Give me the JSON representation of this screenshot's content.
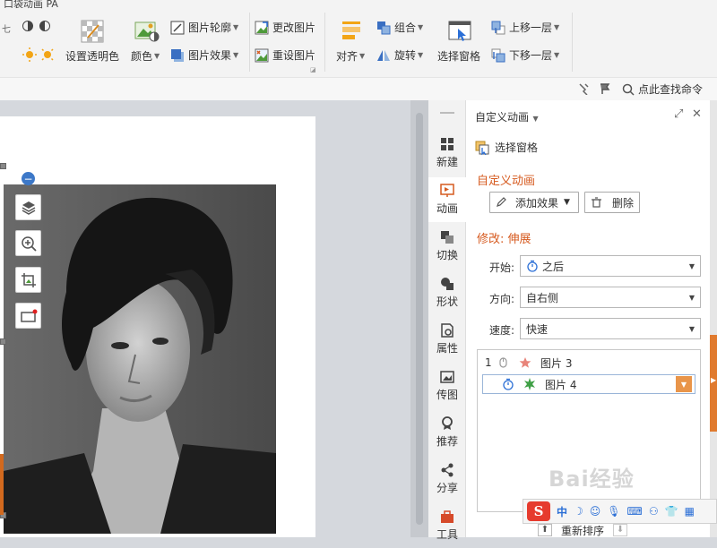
{
  "ribbon": {
    "tab_title": "口袋动画 PA",
    "set_transparent": "设置透明色",
    "color": "颜色",
    "picture_outline": "图片轮廓",
    "picture_effects": "图片效果",
    "change_picture": "更改图片",
    "reset_picture": "重设图片",
    "align": "对齐",
    "group": "组合",
    "rotate": "旋转",
    "selection_pane": "选择窗格",
    "bring_forward": "上移一层",
    "send_backward": "下移一层",
    "search_command": "点此查找命令"
  },
  "tabs": [
    "新建",
    "动画",
    "切换",
    "形状",
    "属性",
    "传图",
    "推荐",
    "分享",
    "工具"
  ],
  "pane": {
    "title": "自定义动画",
    "selection_pane": "选择窗格",
    "section1": "自定义动画",
    "add_effect": "添加效果",
    "delete": "删除",
    "section2": "修改: 伸展",
    "start_label": "开始:",
    "start_value": "之后",
    "direction_label": "方向:",
    "direction_value": "自右侧",
    "speed_label": "速度:",
    "speed_value": "快速",
    "list": [
      {
        "index": "1",
        "name": "图片 3"
      },
      {
        "index": "",
        "name": "图片 4"
      }
    ],
    "reorder": "重新排序"
  },
  "ime": {
    "s": "S",
    "lang": "中"
  },
  "watermark": "Bai经验",
  "colors": {
    "accent": "#d65a1f",
    "orange": "#e07a2e",
    "ime_red": "#e63b2e"
  }
}
